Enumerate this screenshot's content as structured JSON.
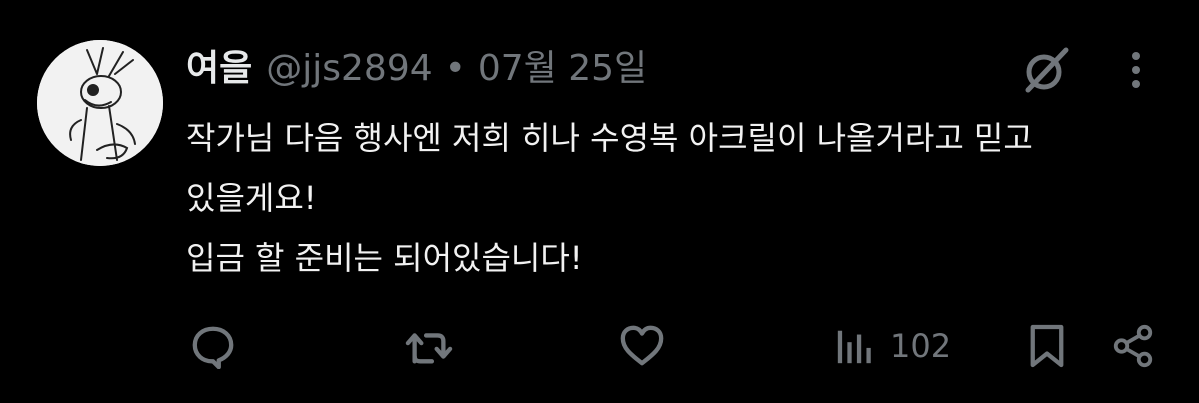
{
  "tweet": {
    "author_name": "여을",
    "handle": "@jjs2894",
    "separator": "•",
    "date": "07월 25일",
    "lines": [
      "작가님 다음 행사엔 저희 히나 수영복 아크릴이 나올거라고 믿고",
      "있을게요!",
      "입금 할 준비는 되어있습니다!"
    ],
    "views": "102"
  },
  "icons": {
    "avatar": "avatar-image",
    "grok": "grok-icon",
    "more": "more-vertical-icon",
    "reply": "reply-icon",
    "retweet": "retweet-icon",
    "like": "heart-icon",
    "views": "views-bar-chart-icon",
    "bookmark": "bookmark-icon",
    "share": "share-icon"
  },
  "colors": {
    "background": "#000000",
    "primary_text": "#e7e9ea",
    "secondary_text": "#71767b",
    "icon": "#71767b"
  }
}
